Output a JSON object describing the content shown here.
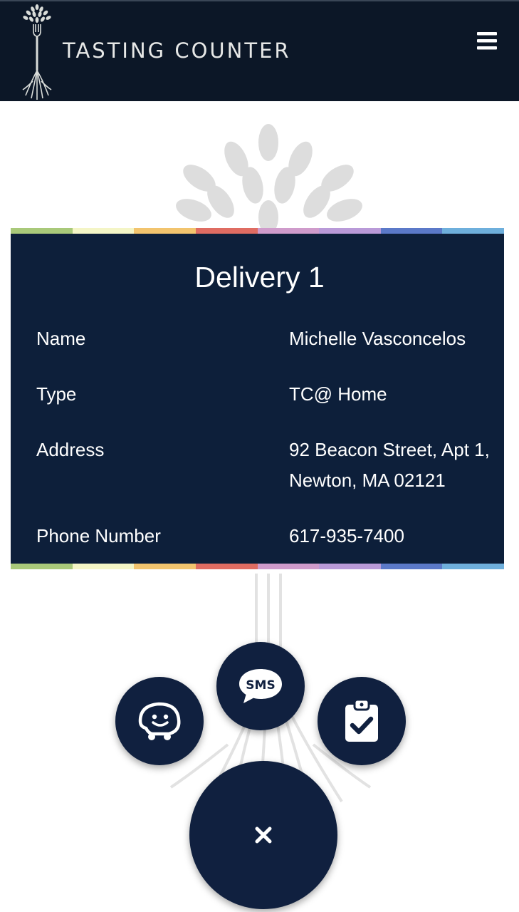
{
  "header": {
    "brand": "TASTING COUNTER",
    "menu_icon": "hamburger-menu-icon"
  },
  "card": {
    "title": "Delivery 1",
    "rows": [
      {
        "label": "Name",
        "value": "Michelle Vasconcelos"
      },
      {
        "label": "Type",
        "value": "TC@ Home"
      },
      {
        "label": "Address",
        "value": "92 Beacon Street, Apt 1, Newton, MA 02121"
      },
      {
        "label": "Phone Number",
        "value": "617-935-7400"
      }
    ],
    "stripe_colors": [
      "#a9c97a",
      "#f4f5c6",
      "#f2c46e",
      "#df6c62",
      "#cf9bcb",
      "#b99ad8",
      "#5b79c8",
      "#6eafdc"
    ]
  },
  "actions": {
    "waze_icon": "waze-icon",
    "sms_icon": "sms-icon",
    "sms_label": "SMS",
    "clipboard_icon": "clipboard-check-icon",
    "close_icon": "close-icon",
    "close_label": "×"
  },
  "colors": {
    "header_bg": "#0c1727",
    "card_bg": "#0d1f3a",
    "fab_bg": "#10203f"
  }
}
